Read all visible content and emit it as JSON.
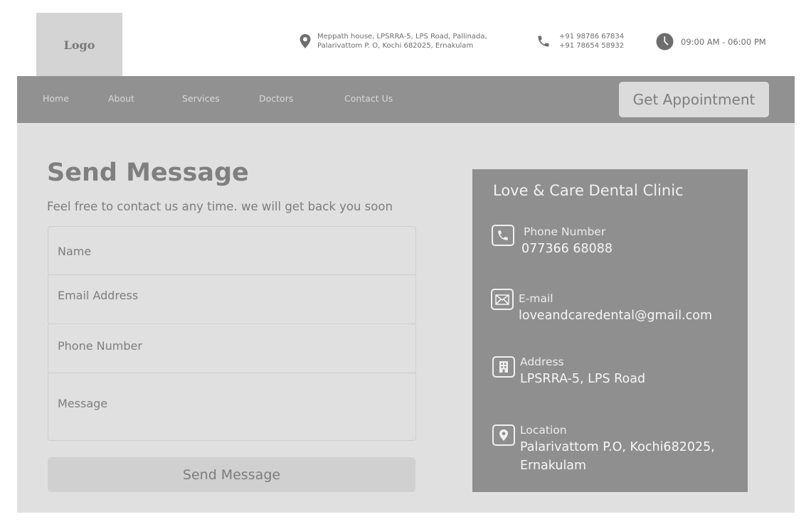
{
  "header": {
    "logo_text": "Logo",
    "address_line1": "Meppath house, LPSRRA-5, LPS Road, Pallinada,",
    "address_line2": "Palarivattom P. O, Kochi 682025, Ernakulam",
    "phone1": "+91 98786 67834",
    "phone2": "+91 78654 58932",
    "hours": "09:00 AM - 06:00 PM"
  },
  "nav": {
    "items": [
      {
        "label": "Home"
      },
      {
        "label": "About"
      },
      {
        "label": "Services"
      },
      {
        "label": "Doctors"
      },
      {
        "label": "Contact Us"
      }
    ],
    "cta_label": "Get Appointment"
  },
  "form": {
    "title": "Send Message",
    "subtitle": "Feel free to contact us any time. we will get back you soon",
    "name_placeholder": "Name",
    "email_placeholder": "Email Address",
    "phone_placeholder": "Phone Number",
    "message_placeholder": "Message",
    "submit_label": "Send Message"
  },
  "contact_card": {
    "title": "Love & Care Dental Clinic",
    "phone_label": "Phone Number",
    "phone_value": "077366 68088",
    "email_label": "E-mail",
    "email_value": "loveandcaredental@gmail.com",
    "address_label": "Address",
    "address_value": "LPSRRA-5, LPS Road",
    "location_label": "Location",
    "location_line1": "Palarivattom P.O, Kochi682025,",
    "location_line2": "Ernakulam"
  },
  "colors": {
    "navbar": "#919191",
    "card": "#8f8f8f",
    "content_bg": "#e1e0e1",
    "logo_bg": "#d5d4d5"
  },
  "icons": [
    "map-pin-icon",
    "phone-icon",
    "clock-icon",
    "mail-icon",
    "building-icon"
  ]
}
